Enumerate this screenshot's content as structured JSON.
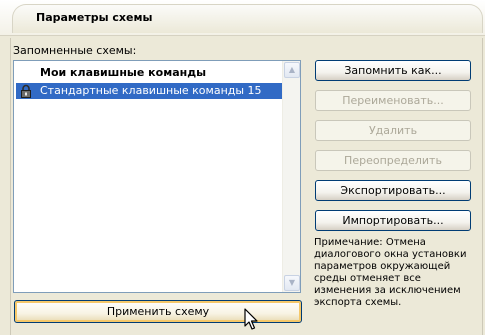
{
  "header": {
    "title": "Параметры схемы"
  },
  "schemes": {
    "label": "Запомненные схемы:",
    "items": [
      {
        "label": "Мои клавишные команды",
        "selected": false,
        "locked": false
      },
      {
        "label": "Стандартные клавишные команды 15",
        "selected": true,
        "locked": true
      }
    ]
  },
  "buttons": {
    "save_as": "Запомнить как...",
    "rename": "Переименовать...",
    "delete": "Удалить",
    "redefine": "Переопределить",
    "export": "Экспортировать...",
    "import": "Импортировать...",
    "apply": "Применить схему"
  },
  "note": "Примечание: Отмена диалогового окна установки параметров окружающей среды отменяет все изменения за исключением экспорта схемы.",
  "colors": {
    "selection": "#316ac5",
    "background": "#ece9d8",
    "button_border": "#003c74"
  }
}
